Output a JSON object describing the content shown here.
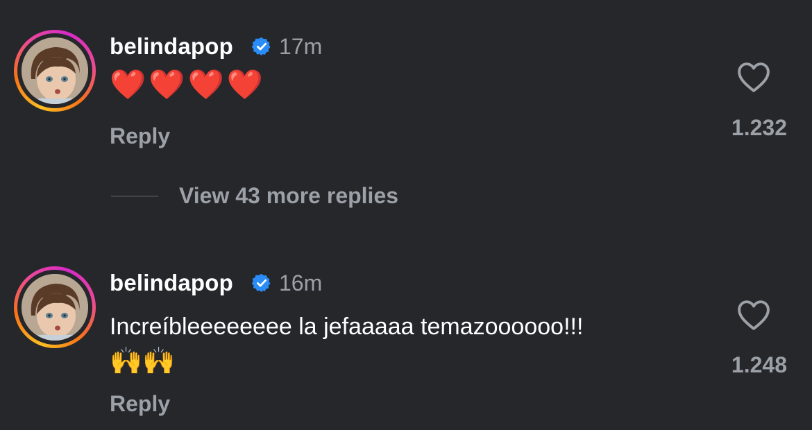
{
  "comments": [
    {
      "username": "belindapop",
      "verified": true,
      "time": "17m",
      "text": "❤️❤️❤️❤️",
      "reply_label": "Reply",
      "likes": "1.232",
      "icons": {
        "avatar": "avatar",
        "verified": "verified-badge-icon",
        "like": "heart-outline-icon"
      }
    },
    {
      "username": "belindapop",
      "verified": true,
      "time": "16m",
      "text": "Increíbleeeeeeee la jefaaaaa temazoooooo!!!",
      "emoji_line": "🙌🙌",
      "reply_label": "Reply",
      "likes": "1.248",
      "icons": {
        "avatar": "avatar",
        "verified": "verified-badge-icon",
        "like": "heart-outline-icon"
      }
    }
  ],
  "more_replies": {
    "label": "View 43 more replies"
  },
  "colors": {
    "background": "#25272b",
    "text_primary": "#ffffff",
    "text_secondary": "#9ca0a7",
    "verified_blue": "#2a8cf7",
    "heart_red": "#e3242b",
    "clap_yellow": "#f5c21b"
  }
}
